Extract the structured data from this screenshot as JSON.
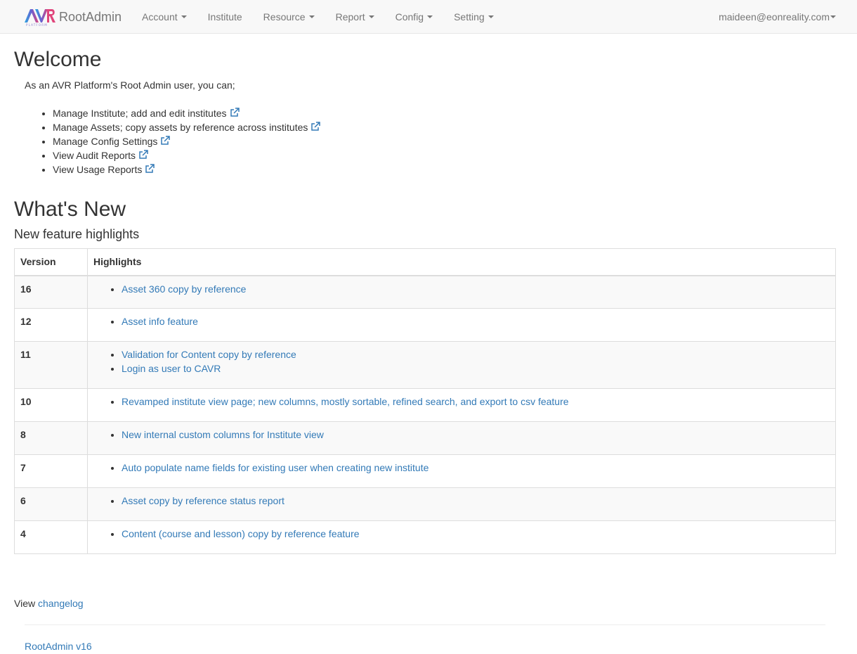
{
  "navbar": {
    "brand": "RootAdmin",
    "items": [
      {
        "label": "Account",
        "dropdown": true
      },
      {
        "label": "Institute",
        "dropdown": false
      },
      {
        "label": "Resource",
        "dropdown": true
      },
      {
        "label": "Report",
        "dropdown": true
      },
      {
        "label": "Config",
        "dropdown": true
      },
      {
        "label": "Setting",
        "dropdown": true
      }
    ],
    "user": "maideen@eonreality.com"
  },
  "welcome": {
    "title": "Welcome",
    "intro": "As an AVR Platform's Root Admin user, you can;",
    "capabilities": [
      "Manage Institute; add and edit institutes",
      "Manage Assets; copy assets by reference across institutes",
      "Manage Config Settings",
      "View Audit Reports",
      "View Usage Reports"
    ]
  },
  "whats_new": {
    "title": "What's New",
    "subtitle": "New feature highlights",
    "headers": {
      "version": "Version",
      "highlights": "Highlights"
    },
    "rows": [
      {
        "version": "16",
        "highlights": [
          "Asset 360 copy by reference"
        ]
      },
      {
        "version": "12",
        "highlights": [
          "Asset info feature"
        ]
      },
      {
        "version": "11",
        "highlights": [
          "Validation for Content copy by reference",
          "Login as user to CAVR"
        ]
      },
      {
        "version": "10",
        "highlights": [
          "Revamped institute view page; new columns, mostly sortable, refined search, and export to csv feature"
        ]
      },
      {
        "version": "8",
        "highlights": [
          "New internal custom columns for Institute view"
        ]
      },
      {
        "version": "7",
        "highlights": [
          "Auto populate name fields for existing user when creating new institute"
        ]
      },
      {
        "version": "6",
        "highlights": [
          "Asset copy by reference status report"
        ]
      },
      {
        "version": "4",
        "highlights": [
          "Content (course and lesson) copy by reference feature"
        ]
      }
    ]
  },
  "changelog": {
    "prefix": "View ",
    "link": "changelog"
  },
  "footer": {
    "version": "RootAdmin v16"
  },
  "colors": {
    "link": "#337ab7",
    "navbar_bg": "#f8f8f8",
    "nav_text": "#777777",
    "text": "#333333"
  }
}
